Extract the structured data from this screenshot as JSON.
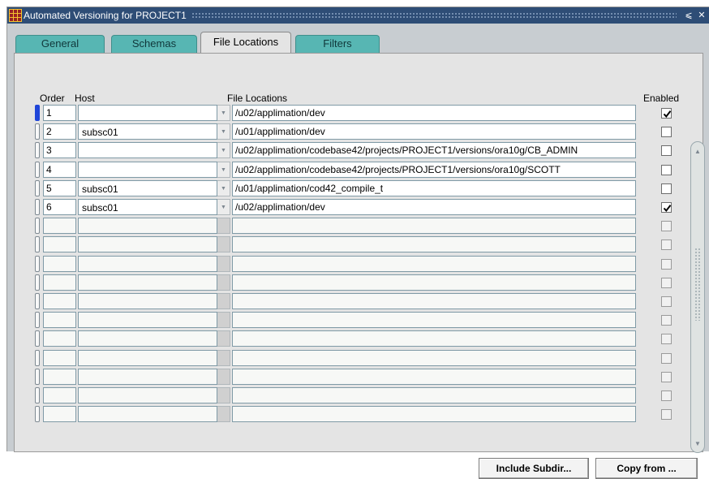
{
  "window": {
    "title": "Automated Versioning for PROJECT1"
  },
  "tabs": [
    {
      "label": "General",
      "active": false
    },
    {
      "label": "Schemas",
      "active": false
    },
    {
      "label": "File Locations",
      "active": true
    },
    {
      "label": "Filters",
      "active": false
    }
  ],
  "columns": {
    "order": "Order",
    "host": "Host",
    "file_locations": "File Locations",
    "enabled": "Enabled"
  },
  "rows": [
    {
      "order": "1",
      "host": "",
      "path": "/u02/applimation/dev",
      "enabled": true
    },
    {
      "order": "2",
      "host": "subsc01",
      "path": "/u01/applimation/dev",
      "enabled": false
    },
    {
      "order": "3",
      "host": "",
      "path": "/u02/applimation/codebase42/projects/PROJECT1/versions/ora10g/CB_ADMIN",
      "enabled": false
    },
    {
      "order": "4",
      "host": "",
      "path": "/u02/applimation/codebase42/projects/PROJECT1/versions/ora10g/SCOTT",
      "enabled": false
    },
    {
      "order": "5",
      "host": "subsc01",
      "path": "/u01/applimation/cod42_compile_t",
      "enabled": false
    },
    {
      "order": "6",
      "host": "subsc01",
      "path": "/u02/applimation/dev",
      "enabled": true
    }
  ],
  "buttons": {
    "include_subdir": "Include Subdir...",
    "copy_from": "Copy from ..."
  },
  "colors": {
    "titlebar": "#2e4d76",
    "tab_inactive": "#57b6b3",
    "current_record": "#1f45d8"
  }
}
